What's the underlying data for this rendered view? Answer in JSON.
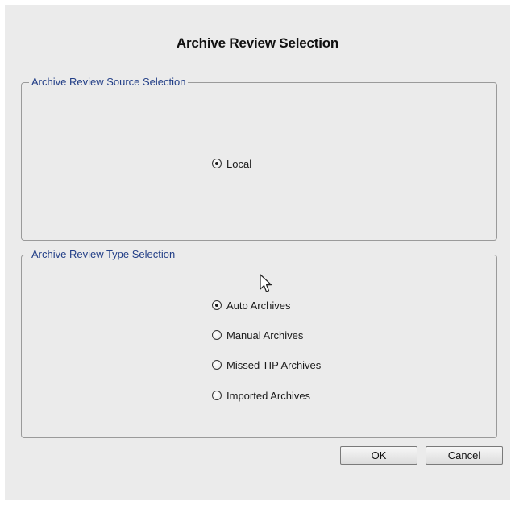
{
  "dialog": {
    "title": "Archive Review Selection"
  },
  "source_group": {
    "legend": "Archive Review Source Selection",
    "options": [
      {
        "label": "Local",
        "checked": true
      }
    ]
  },
  "type_group": {
    "legend": "Archive Review Type Selection",
    "options": [
      {
        "label": "Auto Archives",
        "checked": true
      },
      {
        "label": "Manual Archives",
        "checked": false
      },
      {
        "label": "Missed TIP Archives",
        "checked": false
      },
      {
        "label": "Imported Archives",
        "checked": false
      }
    ]
  },
  "buttons": {
    "ok_label": "OK",
    "cancel_label": "Cancel"
  },
  "icons": {
    "pointer": "mouse-pointer-icon"
  },
  "colors": {
    "dialog_background": "#ebebeb",
    "legend_text": "#233f87",
    "group_border": "#9a9a9a"
  }
}
